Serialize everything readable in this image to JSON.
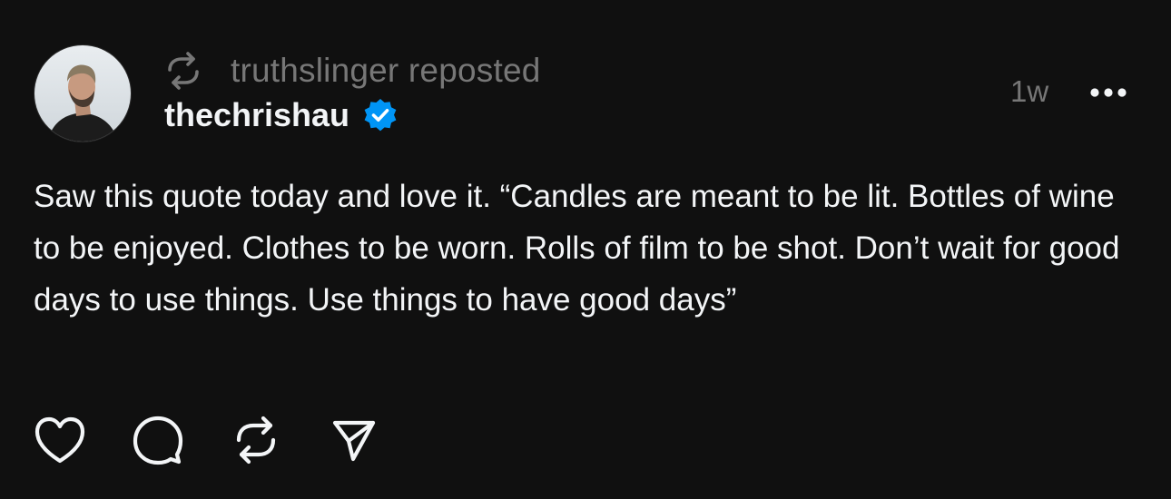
{
  "post": {
    "repost_label": "truthslinger reposted",
    "author": {
      "username": "thechrishau",
      "verified": true
    },
    "timestamp": "1w",
    "text": "Saw this quote today and love it. “Candles are meant to be lit. Bottles of wine to be enjoyed. Clothes to be worn. Rolls of film to be shot. Don’t wait for good days to use things. Use things to have good days”"
  },
  "icons": {
    "repost_indicator": "repost-icon",
    "verified": "verified-badge-icon",
    "more": "more-options-icon",
    "actions": [
      "heart-icon",
      "comment-icon",
      "repost-icon",
      "share-icon"
    ]
  },
  "colors": {
    "background": "#101010",
    "text_primary": "#f3f5f7",
    "text_secondary": "#777777",
    "verified_blue": "#0095f6"
  }
}
